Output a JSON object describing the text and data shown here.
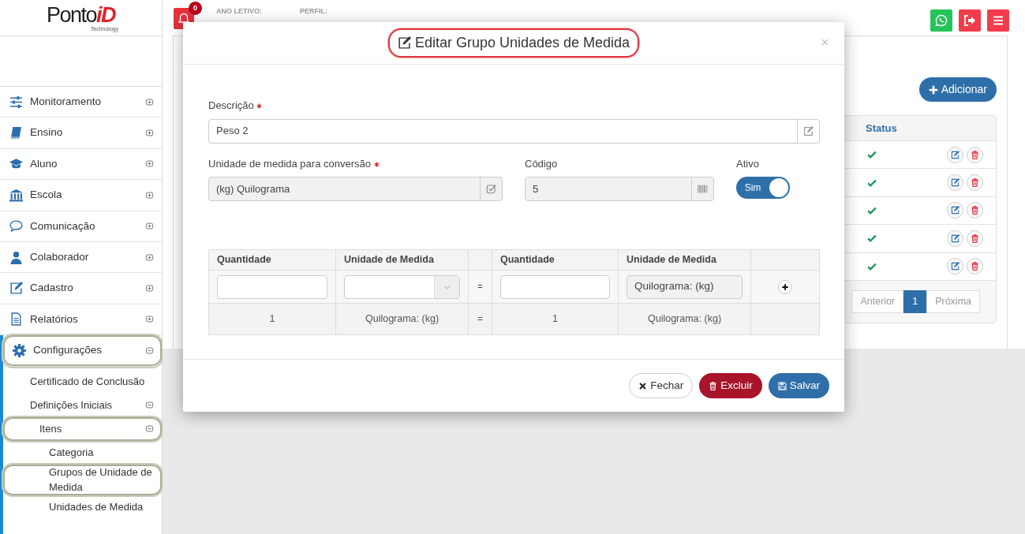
{
  "logo": {
    "text": "Ponto",
    "accent": "iD",
    "tagline": "Technology"
  },
  "header": {
    "notifications": "0",
    "fields": [
      {
        "label": "ANO LETIVO:"
      },
      {
        "label": "PERFIL:"
      }
    ]
  },
  "sidebar": {
    "items": [
      {
        "label": "Monitoramento",
        "expanded": false,
        "highlighted": false
      },
      {
        "label": "Ensino",
        "expanded": false,
        "highlighted": false
      },
      {
        "label": "Aluno",
        "expanded": false,
        "highlighted": false
      },
      {
        "label": "Escola",
        "expanded": false,
        "highlighted": false
      },
      {
        "label": "Comunicação",
        "expanded": false,
        "highlighted": false
      },
      {
        "label": "Colaborador",
        "expanded": false,
        "highlighted": false
      },
      {
        "label": "Cadastro",
        "expanded": false,
        "highlighted": false
      },
      {
        "label": "Relatórios",
        "expanded": false,
        "highlighted": false
      },
      {
        "label": "Configurações",
        "expanded": true,
        "highlighted": true,
        "children": [
          {
            "label": "Certificado de Conclusão",
            "highlighted": false
          },
          {
            "label": "Definições Iniciais",
            "expanded": true,
            "highlighted": false,
            "children": [
              {
                "label": "Itens",
                "expanded": true,
                "highlighted": true,
                "children": [
                  {
                    "label": "Categoria",
                    "highlighted": false
                  },
                  {
                    "label": "Grupos de Unidade de Medida",
                    "highlighted": true
                  },
                  {
                    "label": "Unidades de Medida",
                    "highlighted": false
                  }
                ]
              }
            ]
          }
        ]
      }
    ]
  },
  "page": {
    "add_button": "Adicionar",
    "table": {
      "columns": [
        "Status"
      ],
      "rows": [
        {
          "active": true
        },
        {
          "active": true
        },
        {
          "active": true
        },
        {
          "active": true
        },
        {
          "active": true
        }
      ]
    },
    "pagination": [
      {
        "label": "Anterior",
        "selected": false
      },
      {
        "label": "1",
        "selected": true
      },
      {
        "label": "Próxima",
        "selected": false
      }
    ]
  },
  "modal": {
    "title": "Editar Grupo Unidades de Medida",
    "title_highlighted": true,
    "description": {
      "label": "Descrição",
      "required": true,
      "value": "Peso 2"
    },
    "unit": {
      "label": "Unidade de medida para conversão",
      "required": true,
      "value": "(kg) Quilograma"
    },
    "code": {
      "label": "Código",
      "value": "5"
    },
    "active": {
      "label": "Ativo",
      "on": true,
      "text": "Sim"
    },
    "conversion": {
      "columns": [
        {
          "kind": "label",
          "text": "Quantidade"
        },
        {
          "kind": "label",
          "text": "Unidade de Medida"
        },
        {
          "kind": "blank"
        },
        {
          "kind": "label",
          "text": "Quantidade"
        },
        {
          "kind": "label",
          "text": "Unidade de Medida"
        },
        {
          "kind": "blank"
        }
      ],
      "input_row": [
        {
          "kind": "input"
        },
        {
          "kind": "select"
        },
        {
          "kind": "equals",
          "text": "="
        },
        {
          "kind": "input"
        },
        {
          "kind": "readonly",
          "value": "Quilograma: (kg)"
        },
        {
          "kind": "add"
        }
      ],
      "rows": [
        [
          {
            "kind": "text",
            "text": "1"
          },
          {
            "kind": "text",
            "text": "Quilograma: (kg)"
          },
          {
            "kind": "text",
            "text": "="
          },
          {
            "kind": "text",
            "text": "1"
          },
          {
            "kind": "text",
            "text": "Quilograma: (kg)"
          },
          {
            "kind": "blank"
          }
        ]
      ]
    },
    "buttons": [
      {
        "kind": "close",
        "label": "Fechar"
      },
      {
        "kind": "delete",
        "label": "Excluir"
      },
      {
        "kind": "save",
        "label": "Salvar"
      }
    ]
  }
}
